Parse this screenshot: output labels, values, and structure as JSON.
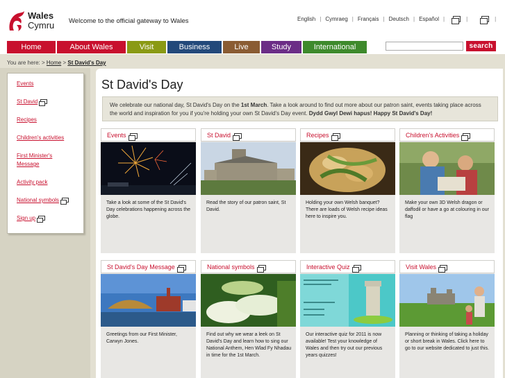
{
  "header": {
    "logo_line1": "Wales",
    "logo_line2": "Cymru",
    "tagline": "Welcome to the official gateway to Wales",
    "languages": [
      "English",
      "Cymraeg",
      "Français",
      "Deutsch",
      "Español"
    ]
  },
  "nav": {
    "tabs": [
      {
        "label": "Home",
        "color": "#c8102e"
      },
      {
        "label": "About Wales",
        "color": "#c8102e"
      },
      {
        "label": "Visit",
        "color": "#8a9a14"
      },
      {
        "label": "Business",
        "color": "#23497a"
      },
      {
        "label": "Live",
        "color": "#8a5c33"
      },
      {
        "label": "Study",
        "color": "#6b2d86"
      },
      {
        "label": "International",
        "color": "#3e8a2c"
      }
    ],
    "search_placeholder": "",
    "search_label": "search"
  },
  "breadcrumb": {
    "prefix": "You are here: >",
    "home": "Home",
    "sep": ">",
    "current": "St David's Day"
  },
  "sidebar": {
    "items": [
      {
        "label": "Events",
        "external": false
      },
      {
        "label": "St David",
        "external": true
      },
      {
        "label": "Recipes",
        "external": false
      },
      {
        "label": "Children's activities",
        "external": false
      },
      {
        "label": "First Minister's Message",
        "external": false
      },
      {
        "label": "Activity pack",
        "external": false
      },
      {
        "label": "National symbols",
        "external": true
      },
      {
        "label": "Sign up",
        "external": true
      }
    ]
  },
  "main": {
    "title": "St David's Day",
    "intro_a": "We celebrate our national day, St David's Day on the ",
    "intro_b": "1st March",
    "intro_c": ". Take a look around to find out more about our patron saint, events taking place across the world and inspiration for you if you're holding your own St David's Day event. ",
    "intro_d": "Dydd Gwyl Dewi hapus! Happy St David's Day!",
    "cards": [
      {
        "title": "Events",
        "desc": "Take a look at some of the St David's Day celebrations happening across the globe.",
        "image": "fireworks"
      },
      {
        "title": "St David",
        "desc": "Read the story of our patron saint, St David.",
        "image": "cathedral"
      },
      {
        "title": "Recipes",
        "desc": "Holding your own Welsh banquet? There are loads of Welsh recipe ideas here to inspire you.",
        "image": "food"
      },
      {
        "title": "Children's Activities",
        "desc": "Make your own 3D Welsh dragon or daffodil or have a go at colouring in our flag",
        "image": "children"
      },
      {
        "title": "St David's Day Message",
        "desc": "Greetings from our First Minister, Carwyn Jones.",
        "image": "bay"
      },
      {
        "title": "National symbols",
        "desc": "Find out why we wear a leek on St David's Day and learn how to sing our National Anthem, Hen Wlad Fy Nhadau in time for the 1st March.",
        "image": "leeks"
      },
      {
        "title": "Interactive Quiz",
        "desc": "Our interactive quiz for 2011 is now available! Test your knowledge of Wales and then try out our previous years quizzes!",
        "image": "quiz"
      },
      {
        "title": "Visit Wales",
        "desc": "Planning or thinking of taking a holiday or short break in Wales. Click here to go to our website dedicated to just this.",
        "image": "castle"
      }
    ]
  }
}
